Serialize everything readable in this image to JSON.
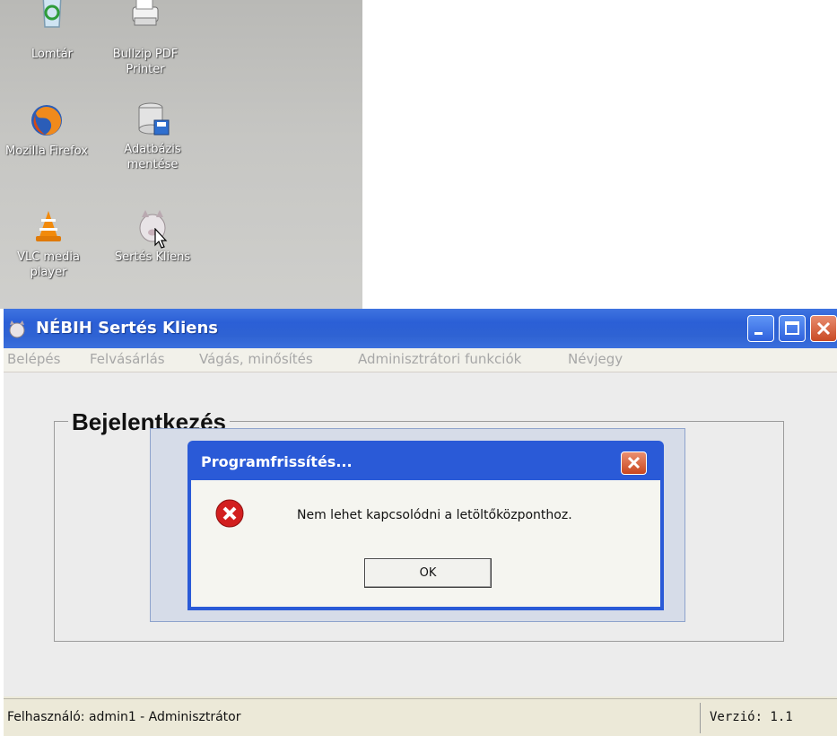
{
  "desktop": {
    "icons": [
      {
        "label": "Lomtár",
        "icon": "recycle-bin-icon"
      },
      {
        "label": "Bullzip PDF\nPrinter",
        "icon": "printer-icon"
      },
      {
        "label": "Mozilla Firefox",
        "icon": "firefox-icon"
      },
      {
        "label": "Adatbázis\nmentése",
        "icon": "database-save-icon"
      },
      {
        "label": "VLC media\nplayer",
        "icon": "vlc-cone-icon"
      },
      {
        "label": "Sertés Kliens",
        "icon": "pig-app-icon"
      }
    ]
  },
  "window": {
    "title": "NÉBIH Sertés Kliens",
    "menu": [
      "Belépés",
      "Felvásárlás",
      "Vágás, minősítés",
      "Adminisztrátori funkciók",
      "Névjegy"
    ],
    "group_title": "Bejelentkezés",
    "status_left": "Felhasználó: admin1 - Adminisztrátor",
    "status_right": "Verzió: 1.1"
  },
  "dialog": {
    "title": "Programfrissítés...",
    "message": "Nem lehet kapcsolódni a letöltőközponthoz.",
    "ok_label": "OK",
    "icon": "error-icon"
  },
  "colors": {
    "titlebar": "#2f63d3",
    "dialog_frame": "#2a5ad7",
    "close_button": "#d5532c",
    "error_red": "#d21f1f"
  }
}
